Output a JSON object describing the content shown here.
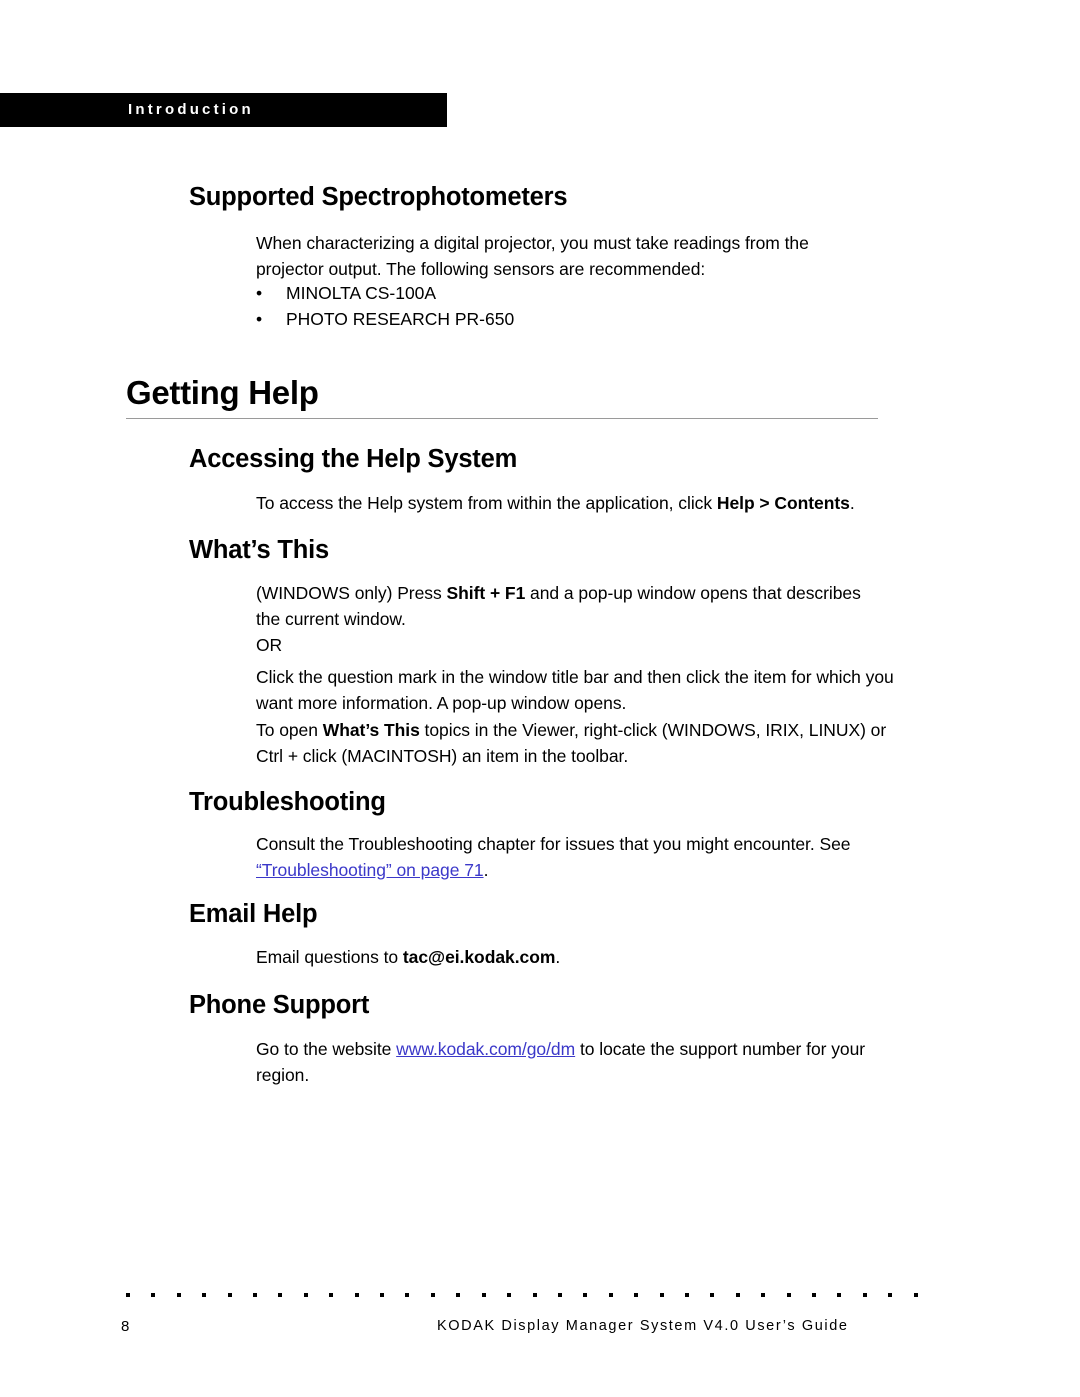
{
  "header": {
    "chapter_label": "Introduction"
  },
  "sections": {
    "supported_spectrophotometers": {
      "heading": "Supported Spectrophotometers",
      "paragraph": "When characterizing a digital projector, you must take readings from the projector output. The following sensors are recommended:",
      "bullets": [
        "MINOLTA CS-100A",
        "PHOTO RESEARCH PR-650"
      ],
      "bullet_glyph": "•"
    },
    "getting_help": {
      "heading": "Getting Help"
    },
    "accessing_help_system": {
      "heading": "Accessing the Help System",
      "text_before": "To access the Help system from within the application, click ",
      "bold_run": "Help > Contents",
      "text_after": "."
    },
    "whats_this": {
      "heading": "What’s This",
      "p1_before": "(WINDOWS only) Press ",
      "p1_bold": "Shift + F1",
      "p1_after": " and a pop-up window opens that describes the current window.",
      "or_label": "OR",
      "p2": "Click the question mark in the window title bar and then click the item for which you want more information. A pop-up window opens.",
      "p3_before": "To open ",
      "p3_bold": "What’s This",
      "p3_after": " topics in the Viewer, right-click (WINDOWS, IRIX, LINUX) or Ctrl + click (MACINTOSH) an item in the toolbar."
    },
    "troubleshooting": {
      "heading": "Troubleshooting",
      "text_before": "Consult the Troubleshooting chapter for issues that you might encounter. See ",
      "link_text": "“Troubleshooting” on page 71",
      "text_after": "."
    },
    "email_help": {
      "heading": "Email Help",
      "text_before": "Email questions to ",
      "bold_run": "tac@ei.kodak.com",
      "text_after": "."
    },
    "phone_support": {
      "heading": "Phone Support",
      "text_before": "Go to the website ",
      "link_text": "www.kodak.com/go/dm",
      "text_after": " to locate the support number for your region."
    }
  },
  "footer": {
    "page_number": "8",
    "text": "KODAK Display Manager System V4.0 User’s Guide"
  },
  "colors": {
    "link": "#3b38c9",
    "header_bar": "#000000",
    "rule": "#9a9a9a"
  }
}
